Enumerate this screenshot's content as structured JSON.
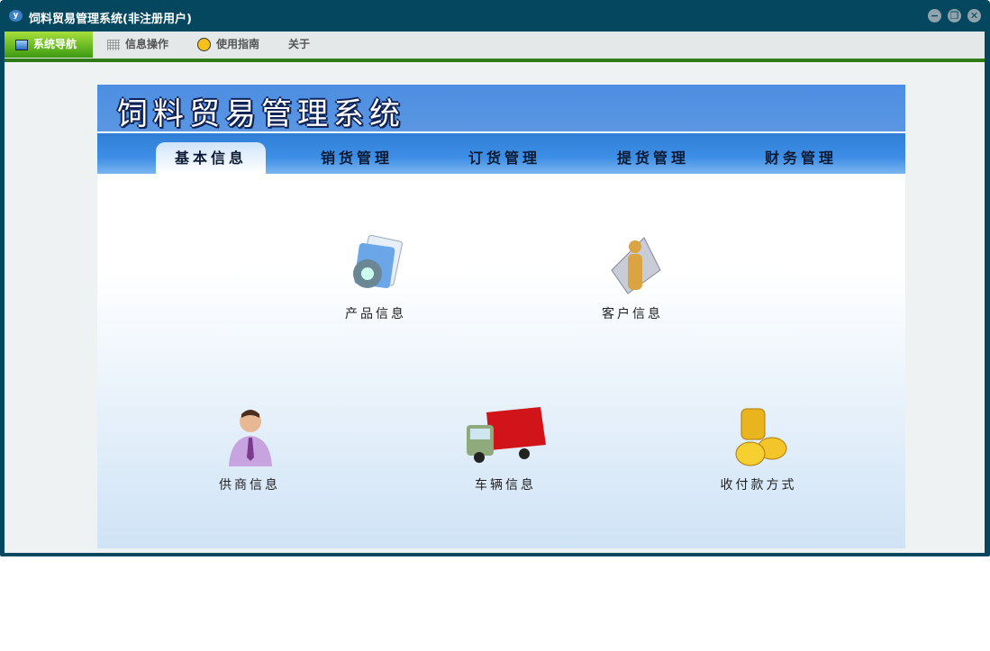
{
  "window": {
    "title": "饲料贸易管理系统(非注册用户)",
    "icon": "app-logo-icon"
  },
  "menubar": [
    {
      "label": "系统导航",
      "icon": "monitor-icon",
      "active": true
    },
    {
      "label": "信息操作",
      "icon": "grid-icon"
    },
    {
      "label": "使用指南",
      "icon": "help-icon"
    },
    {
      "label": "关于"
    }
  ],
  "banner": {
    "title": "饲料贸易管理系统"
  },
  "tabs": [
    {
      "label": "基本信息",
      "active": true
    },
    {
      "label": "销货管理"
    },
    {
      "label": "订货管理"
    },
    {
      "label": "提货管理"
    },
    {
      "label": "财务管理"
    }
  ],
  "items": [
    {
      "label": "产品信息",
      "icon": "product-gear-icon"
    },
    {
      "label": "客户信息",
      "icon": "customer-icon"
    },
    {
      "label": "供商信息",
      "icon": "supplier-person-icon"
    },
    {
      "label": "车辆信息",
      "icon": "truck-icon"
    },
    {
      "label": "收付款方式",
      "icon": "gold-coins-icon"
    }
  ]
}
